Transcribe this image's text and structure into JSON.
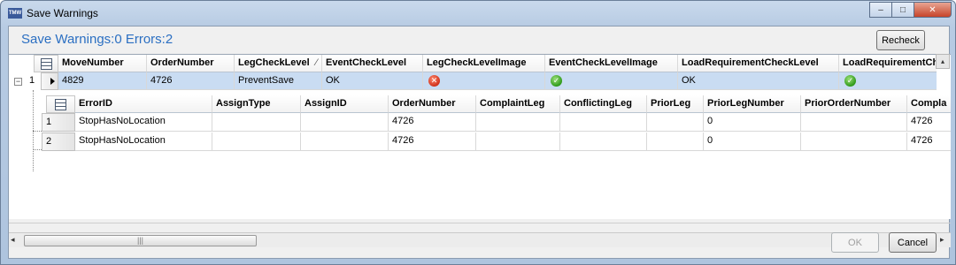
{
  "window": {
    "icon_text": "TMW",
    "title": "Save Warnings",
    "minimize_glyph": "–",
    "maximize_glyph": "□",
    "close_glyph": "✕"
  },
  "heading": "Save Warnings:0 Errors:2",
  "toolbar": {
    "recheck_label": "Recheck"
  },
  "parent_grid": {
    "columns": [
      "MoveNumber",
      "OrderNumber",
      "LegCheckLevel",
      "EventCheckLevel",
      "LegCheckLevelImage",
      "EventCheckLevelImage",
      "LoadRequirementCheckLevel",
      "LoadRequirementChe"
    ],
    "sort_indicator": "⁄",
    "row": {
      "index": "1",
      "expander": "−",
      "MoveNumber": "4829",
      "OrderNumber": "4726",
      "LegCheckLevel": "PreventSave",
      "EventCheckLevel": "OK",
      "LegCheckLevelImage": "error-icon",
      "EventCheckLevelImage": "ok-icon",
      "LoadRequirementCheckLevel": "OK",
      "LoadRequirementChe": "ok-icon"
    }
  },
  "child_grid": {
    "columns": [
      "ErrorID",
      "AssignType",
      "AssignID",
      "OrderNumber",
      "ComplaintLeg",
      "ConflictingLeg",
      "PriorLeg",
      "PriorLegNumber",
      "PriorOrderNumber",
      "Compla"
    ],
    "rows": [
      {
        "index": "1",
        "ErrorID": "StopHasNoLocation",
        "AssignType": "",
        "AssignID": "",
        "OrderNumber": "4726",
        "ComplaintLeg": "",
        "ConflictingLeg": "",
        "PriorLeg": "",
        "PriorLegNumber": "0",
        "PriorOrderNumber": "",
        "Compla": "4726"
      },
      {
        "index": "2",
        "ErrorID": "StopHasNoLocation",
        "AssignType": "",
        "AssignID": "",
        "OrderNumber": "4726",
        "ComplaintLeg": "",
        "ConflictingLeg": "",
        "PriorLeg": "",
        "PriorLegNumber": "0",
        "PriorOrderNumber": "",
        "Compla": "4726"
      }
    ]
  },
  "scrollbar": {
    "left_glyph": "◂",
    "right_glyph": "▸",
    "thumb_grip": "|||",
    "up_glyph": "▴"
  },
  "footer": {
    "ok_label": "OK",
    "cancel_label": "Cancel"
  }
}
